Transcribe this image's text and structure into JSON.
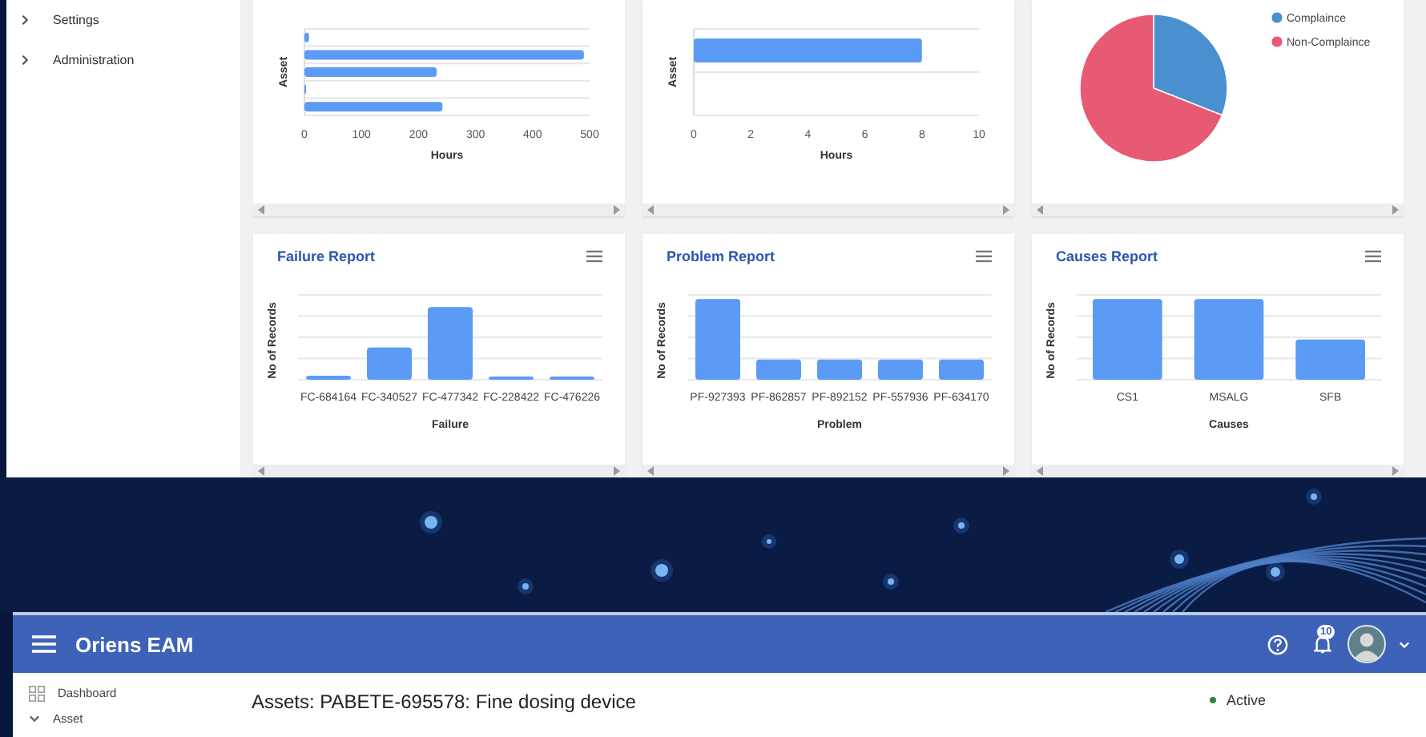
{
  "top_screen": {
    "sidebar": [
      {
        "label": "Settings",
        "expanded": false
      },
      {
        "label": "Administration",
        "expanded": false
      }
    ],
    "top_cards": [
      {
        "kind": "hbar",
        "chart_data": {
          "type": "bar",
          "orientation": "horizontal",
          "xlabel": "Hours",
          "ylabel": "Asset",
          "values": [
            8,
            490,
            232,
            2,
            242
          ],
          "xlim": [
            0,
            500
          ],
          "xticks": [
            0,
            100,
            200,
            300,
            400,
            500
          ]
        }
      },
      {
        "kind": "hbar",
        "chart_data": {
          "type": "bar",
          "orientation": "horizontal",
          "xlabel": "Hours",
          "ylabel": "Asset",
          "values": [
            8,
            0
          ],
          "xlim": [
            0,
            10
          ],
          "xticks": [
            0,
            2,
            4,
            6,
            8,
            10
          ]
        }
      },
      {
        "kind": "pie",
        "legend": [
          {
            "label": "Complaince",
            "color": "#4a8fd0"
          },
          {
            "label": "Non-Complaince",
            "color": "#e85a74"
          }
        ]
      }
    ],
    "report_cards": [
      {
        "title": "Failure Report",
        "ylabel": "No of Records",
        "xlabel": "Failure",
        "categories": [
          "FC-684164",
          "FC-340527",
          "FC-477342",
          "FC-228422",
          "FC-476226"
        ]
      },
      {
        "title": "Problem Report",
        "ylabel": "No of Records",
        "xlabel": "Problem",
        "categories": [
          "PF-927393",
          "PF-862857",
          "PF-892152",
          "PF-557936",
          "PF-634170"
        ]
      },
      {
        "title": "Causes Report",
        "ylabel": "No of Records",
        "xlabel": "Causes",
        "categories": [
          "CS1",
          "MSALG",
          "SFB"
        ]
      }
    ]
  },
  "app": {
    "brand": "Oriens EAM",
    "notification_count": "10",
    "sidebar": [
      {
        "label": "Dashboard",
        "kind": "link"
      },
      {
        "label": "Asset",
        "kind": "group",
        "expanded": true
      }
    ],
    "page_title": "Assets: PABETE-695578: Fine dosing device",
    "status": "Active"
  }
}
